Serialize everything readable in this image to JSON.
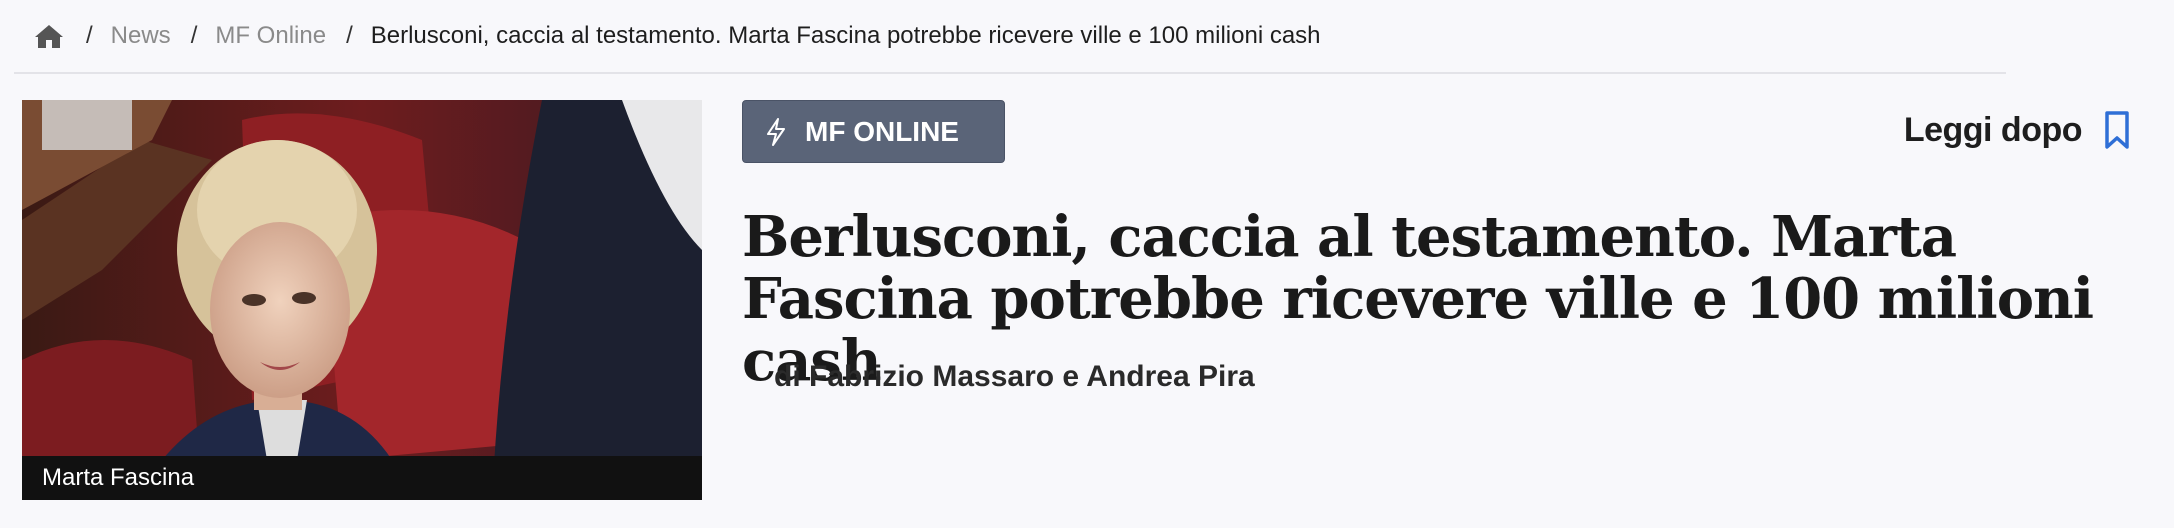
{
  "breadcrumb": {
    "home_icon": "home-icon",
    "separator": "/",
    "items": [
      {
        "label": "News"
      },
      {
        "label": "MF Online"
      }
    ],
    "current": "Berlusconi, caccia al testamento. Marta Fascina potrebbe ricevere ville e 100 milioni cash"
  },
  "hero": {
    "caption": "Marta Fascina"
  },
  "badge": {
    "icon": "bolt-icon",
    "label": "MF ONLINE",
    "color": "#5a6478"
  },
  "read_later": {
    "label": "Leggi dopo",
    "icon": "bookmark-icon",
    "icon_color": "#2f6fd6"
  },
  "article": {
    "title": "Berlusconi, caccia al testamento. Marta Fascina potrebbe ricevere ville e 100 milioni cash",
    "byline": "di Fabrizio Massaro e Andrea Pira"
  }
}
